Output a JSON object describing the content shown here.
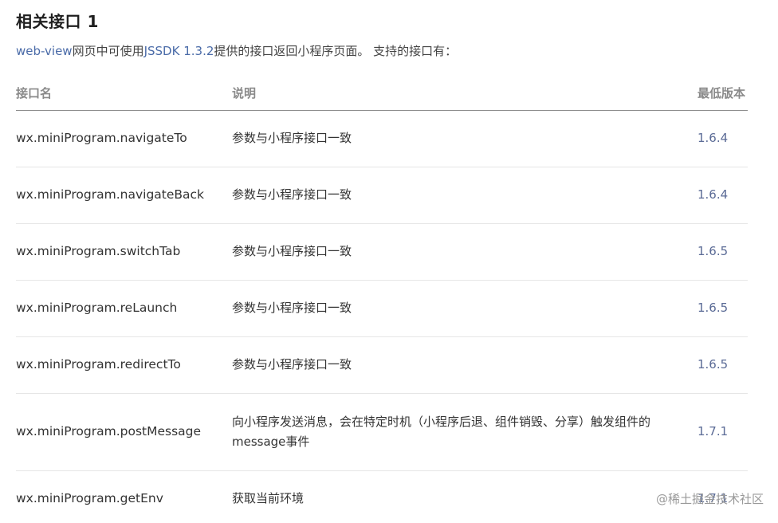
{
  "heading": "相关接口 1",
  "intro": {
    "link1": "web-view",
    "text1": "网页中可使用",
    "link2": "JSSDK 1.3.2",
    "text2": "提供的接口返回小程序页面。 支持的接口有："
  },
  "table": {
    "headers": [
      "接口名",
      "说明",
      "最低版本"
    ],
    "rows": [
      {
        "name": "wx.miniProgram.navigateTo",
        "desc": "参数与小程序接口一致",
        "version": "1.6.4"
      },
      {
        "name": "wx.miniProgram.navigateBack",
        "desc": "参数与小程序接口一致",
        "version": "1.6.4"
      },
      {
        "name": "wx.miniProgram.switchTab",
        "desc": "参数与小程序接口一致",
        "version": "1.6.5"
      },
      {
        "name": "wx.miniProgram.reLaunch",
        "desc": "参数与小程序接口一致",
        "version": "1.6.5"
      },
      {
        "name": "wx.miniProgram.redirectTo",
        "desc": "参数与小程序接口一致",
        "version": "1.6.5"
      },
      {
        "name": "wx.miniProgram.postMessage",
        "desc": "向小程序发送消息，会在特定时机（小程序后退、组件销毁、分享）触发组件的message事件",
        "version": "1.7.1"
      },
      {
        "name": "wx.miniProgram.getEnv",
        "desc": "获取当前环境",
        "version": "1.7.1"
      }
    ]
  },
  "watermark": "@稀土掘金技术社区",
  "colors": {
    "link": "#4a6ba8",
    "version": "#5b6b96",
    "header_text": "#8a8a8a",
    "row_border": "#e6e6e6"
  }
}
